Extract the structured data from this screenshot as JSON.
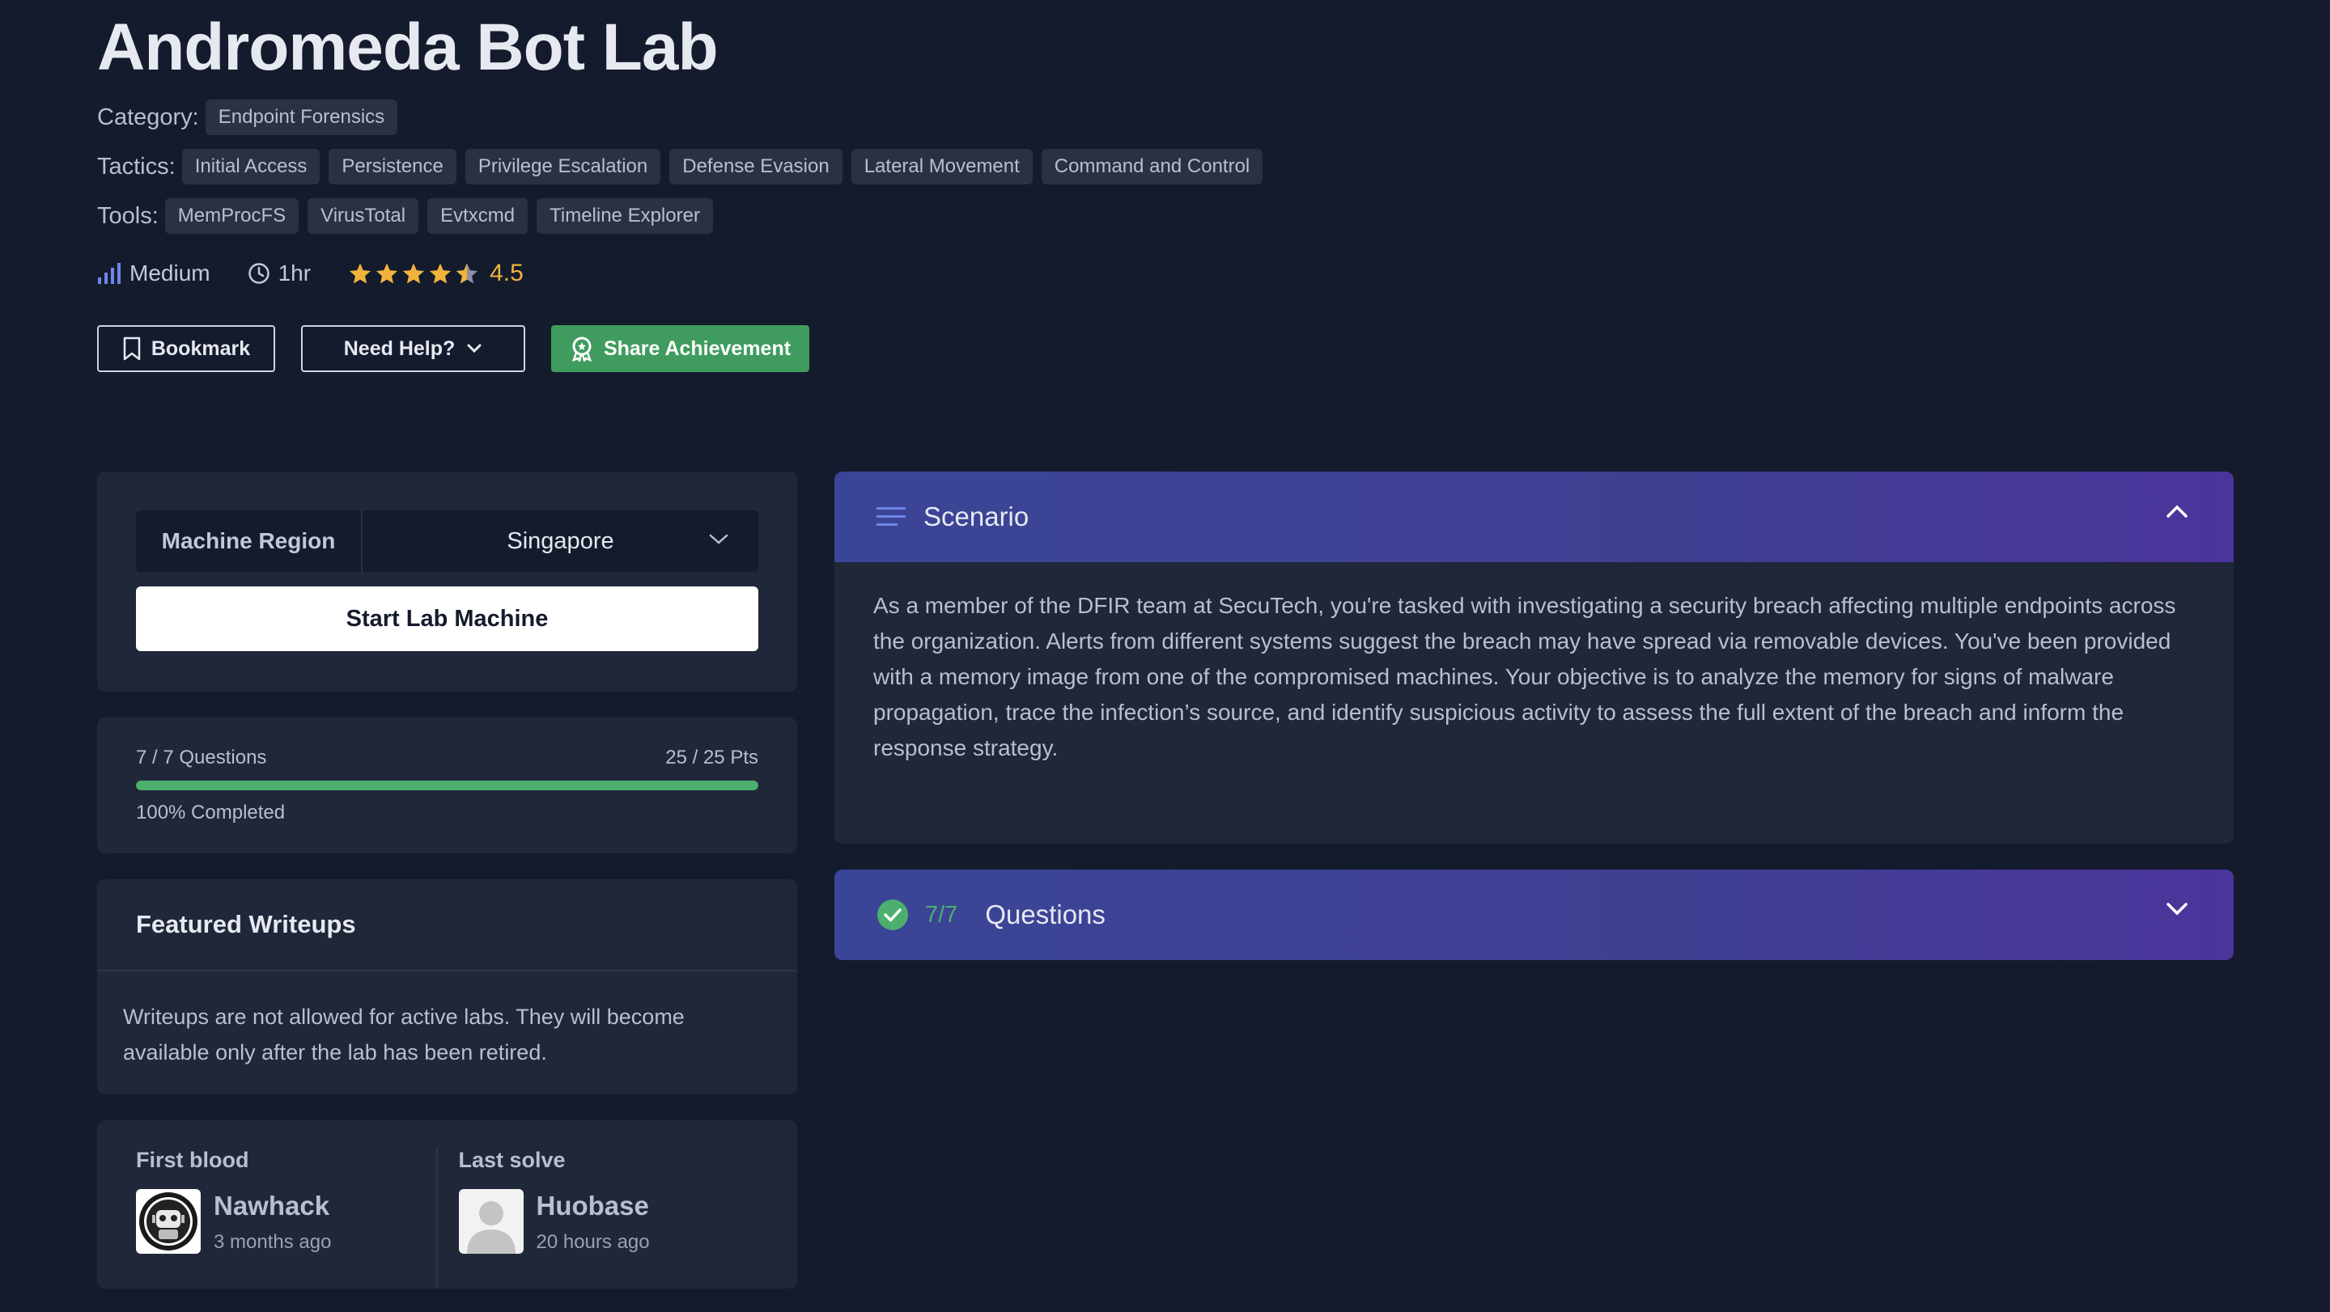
{
  "lab": {
    "title": "Andromeda Bot Lab",
    "category_label": "Category:",
    "category": "Endpoint Forensics",
    "tactics_label": "Tactics:",
    "tactics": [
      "Initial Access",
      "Persistence",
      "Privilege Escalation",
      "Defense Evasion",
      "Lateral Movement",
      "Command and Control"
    ],
    "tools_label": "Tools:",
    "tools": [
      "MemProcFS",
      "VirusTotal",
      "Evtxcmd",
      "Timeline Explorer"
    ],
    "difficulty": "Medium",
    "duration": "1hr",
    "rating": "4.5",
    "rating_value": 4.5,
    "rating_max": 5
  },
  "actions": {
    "bookmark": "Bookmark",
    "help": "Need Help?",
    "share": "Share Achievement"
  },
  "machine": {
    "region_label": "Machine Region",
    "region_value": "Singapore",
    "start_label": "Start Lab Machine"
  },
  "progress": {
    "questions": "7 / 7 Questions",
    "points": "25 / 25 Pts",
    "completed": "100% Completed",
    "fraction": 1.0
  },
  "writeups": {
    "title": "Featured Writeups",
    "message": "Writeups are not allowed for active labs. They will become available only after the lab has been retired."
  },
  "solves": {
    "first_label": "First blood",
    "first_name": "Nawhack",
    "first_time": "3 months ago",
    "last_label": "Last solve",
    "last_name": "Huobase",
    "last_time": "20 hours ago"
  },
  "scenario": {
    "title": "Scenario",
    "text": "As a member of the DFIR team at SecuTech, you're tasked with investigating a security breach affecting multiple endpoints across the organization. Alerts from different systems suggest the breach may have spread via removable devices. You've been provided with a memory image from one of the compromised machines. Your objective is to analyze the memory for signs of malware propagation, trace the infection’s source, and identify suspicious activity to assess the full extent of the breach and inform the response strategy."
  },
  "questions": {
    "count": "7/7",
    "title": "Questions"
  },
  "colors": {
    "background": "#141b2d",
    "card": "#1f2739",
    "accent_green": "#3f9c5e",
    "star": "#f0b43c",
    "panel_gradient_start": "#3b4597",
    "panel_gradient_end": "#4b349b"
  }
}
